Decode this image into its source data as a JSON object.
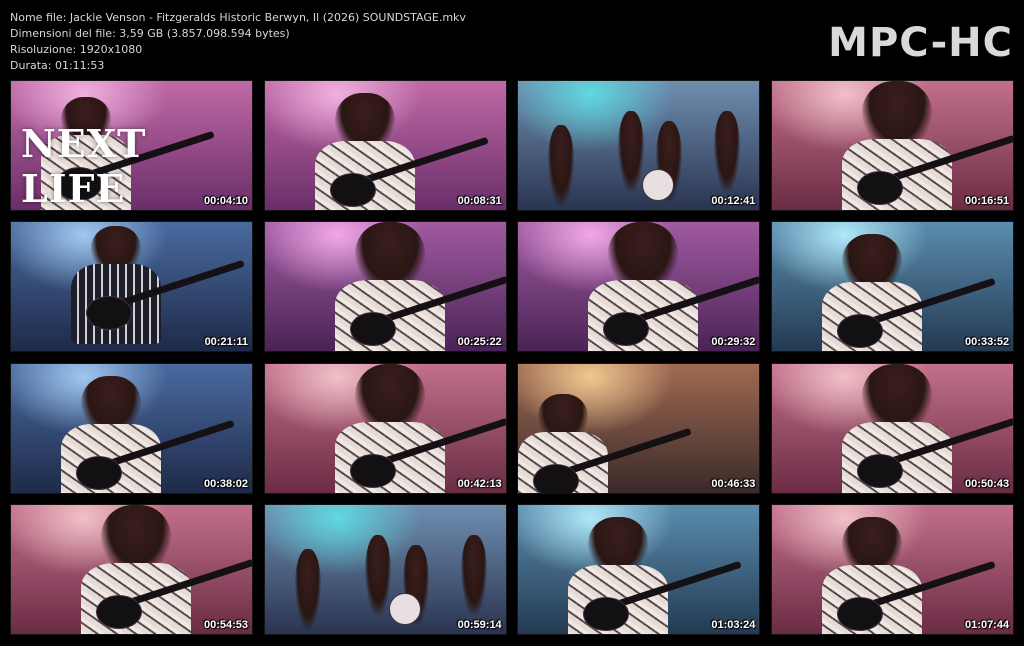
{
  "header": {
    "file_name": "Nome file: Jackie Venson - Fitzgeralds Historic Berwyn, Il (2026) SOUNDSTAGE.mkv",
    "file_size": "Dimensioni del file: 3,59 GB (3.857.098.594 bytes)",
    "resolution": "Risoluzione: 1920x1080",
    "duration": "Durata: 01:11:53"
  },
  "brand": "MPC-HC",
  "overlay_title": "NEXT LIFE",
  "thumbnails": [
    {
      "time": "00:04:10",
      "tone": "magenta",
      "shot": "wide-title"
    },
    {
      "time": "00:08:31",
      "tone": "magenta",
      "shot": "medium"
    },
    {
      "time": "00:12:41",
      "tone": "teal",
      "shot": "stage"
    },
    {
      "time": "00:16:51",
      "tone": "rose",
      "shot": "close"
    },
    {
      "time": "00:21:11",
      "tone": "blue",
      "shot": "bassist"
    },
    {
      "time": "00:25:22",
      "tone": "violet",
      "shot": "close"
    },
    {
      "time": "00:29:32",
      "tone": "violet",
      "shot": "close"
    },
    {
      "time": "00:33:52",
      "tone": "cyan",
      "shot": "medium"
    },
    {
      "time": "00:38:02",
      "tone": "blue",
      "shot": "medium"
    },
    {
      "time": "00:42:13",
      "tone": "rose",
      "shot": "close"
    },
    {
      "time": "00:46:33",
      "tone": "amber",
      "shot": "drummer"
    },
    {
      "time": "00:50:43",
      "tone": "rose",
      "shot": "close"
    },
    {
      "time": "00:54:53",
      "tone": "rose",
      "shot": "close"
    },
    {
      "time": "00:59:14",
      "tone": "teal",
      "shot": "stage"
    },
    {
      "time": "01:03:24",
      "tone": "cyan",
      "shot": "medium"
    },
    {
      "time": "01:07:44",
      "tone": "rose",
      "shot": "medium"
    }
  ],
  "colors": {
    "magenta": "#a0508c",
    "teal": "#5a7ea0",
    "rose": "#a8506a",
    "blue": "#3c5a8c",
    "violet": "#8a4a88",
    "cyan": "#4a7896",
    "amber": "#8a5a46"
  }
}
